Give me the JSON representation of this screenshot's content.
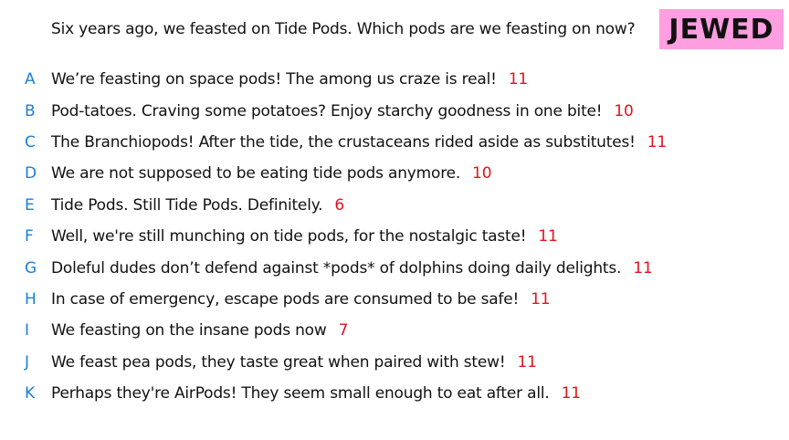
{
  "colors": {
    "letter": "#1a7fd8",
    "score": "#e0141e",
    "badge_bg": "#ff9ee0",
    "text": "#111111"
  },
  "question": "Six years ago, we feasted on Tide Pods. Which pods are we feasting on now?",
  "badge": "JEWED",
  "answers": [
    {
      "letter": "A",
      "text": "We’re feasting on space pods! The among us craze is real!",
      "score": "11"
    },
    {
      "letter": "B",
      "text": "Pod-tatoes. Craving some potatoes? Enjoy starchy goodness in one bite!",
      "score": "10"
    },
    {
      "letter": "C",
      "text": "The Branchiopods! After the tide, the crustaceans rided aside as substitutes!",
      "score": "11"
    },
    {
      "letter": "D",
      "text": "We are not supposed to be eating tide pods anymore.",
      "score": "10"
    },
    {
      "letter": "E",
      "text": "Tide Pods. Still Tide Pods. Definitely.",
      "score": "6"
    },
    {
      "letter": "F",
      "text": "Well, we're still munching on tide pods, for the nostalgic taste!",
      "score": "11"
    },
    {
      "letter": "G",
      "text": "Doleful dudes don’t defend against *pods* of dolphins doing daily delights.",
      "score": "11"
    },
    {
      "letter": "H",
      "text": "In case of emergency, escape pods are consumed to be safe!",
      "score": "11"
    },
    {
      "letter": "I",
      "text": "We feasting on the insane pods now",
      "score": "7"
    },
    {
      "letter": "J",
      "text": "We feast pea pods, they taste great when paired with stew!",
      "score": "11"
    },
    {
      "letter": "K",
      "text": "Perhaps they're AirPods! They seem small enough to eat after all.",
      "score": "11"
    }
  ]
}
